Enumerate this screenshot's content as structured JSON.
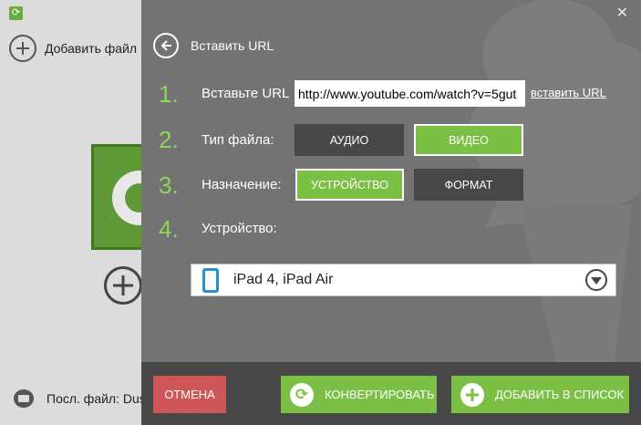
{
  "background_app": {
    "add_file_label": "Добавить файл",
    "last_file_label": "Посл. файл: Dus"
  },
  "overlay": {
    "close_glyph": "✕",
    "header_title": "Вставить URL",
    "steps": [
      {
        "num": "1.",
        "label": "Вставьте URL"
      },
      {
        "num": "2.",
        "label": "Тип файла:"
      },
      {
        "num": "3.",
        "label": "Назначение:"
      },
      {
        "num": "4.",
        "label": "Устройство:"
      }
    ],
    "url_value": "http://www.youtube.com/watch?v=5gut",
    "paste_url_link": "вставить URL",
    "file_type": {
      "audio_label": "АУДИО",
      "video_label": "ВИДЕО",
      "selected": "video"
    },
    "destination": {
      "device_label": "УСТРОЙСТВО",
      "format_label": "ФОРМАТ",
      "selected": "device"
    },
    "device": {
      "value": "iPad 4, iPad Air",
      "icon": "tablet-icon"
    }
  },
  "footer": {
    "cancel_label": "ОТМЕНА",
    "convert_label": "КОНВЕРТИРОВАТЬ",
    "add_to_list_label": "ДОБАВИТЬ В СПИСОК"
  },
  "colors": {
    "accent_green": "#7cbf45",
    "step_green": "#8fd45b",
    "cancel_red": "#cf5656",
    "panel_gray": "#737373",
    "footer_gray": "#484848"
  }
}
